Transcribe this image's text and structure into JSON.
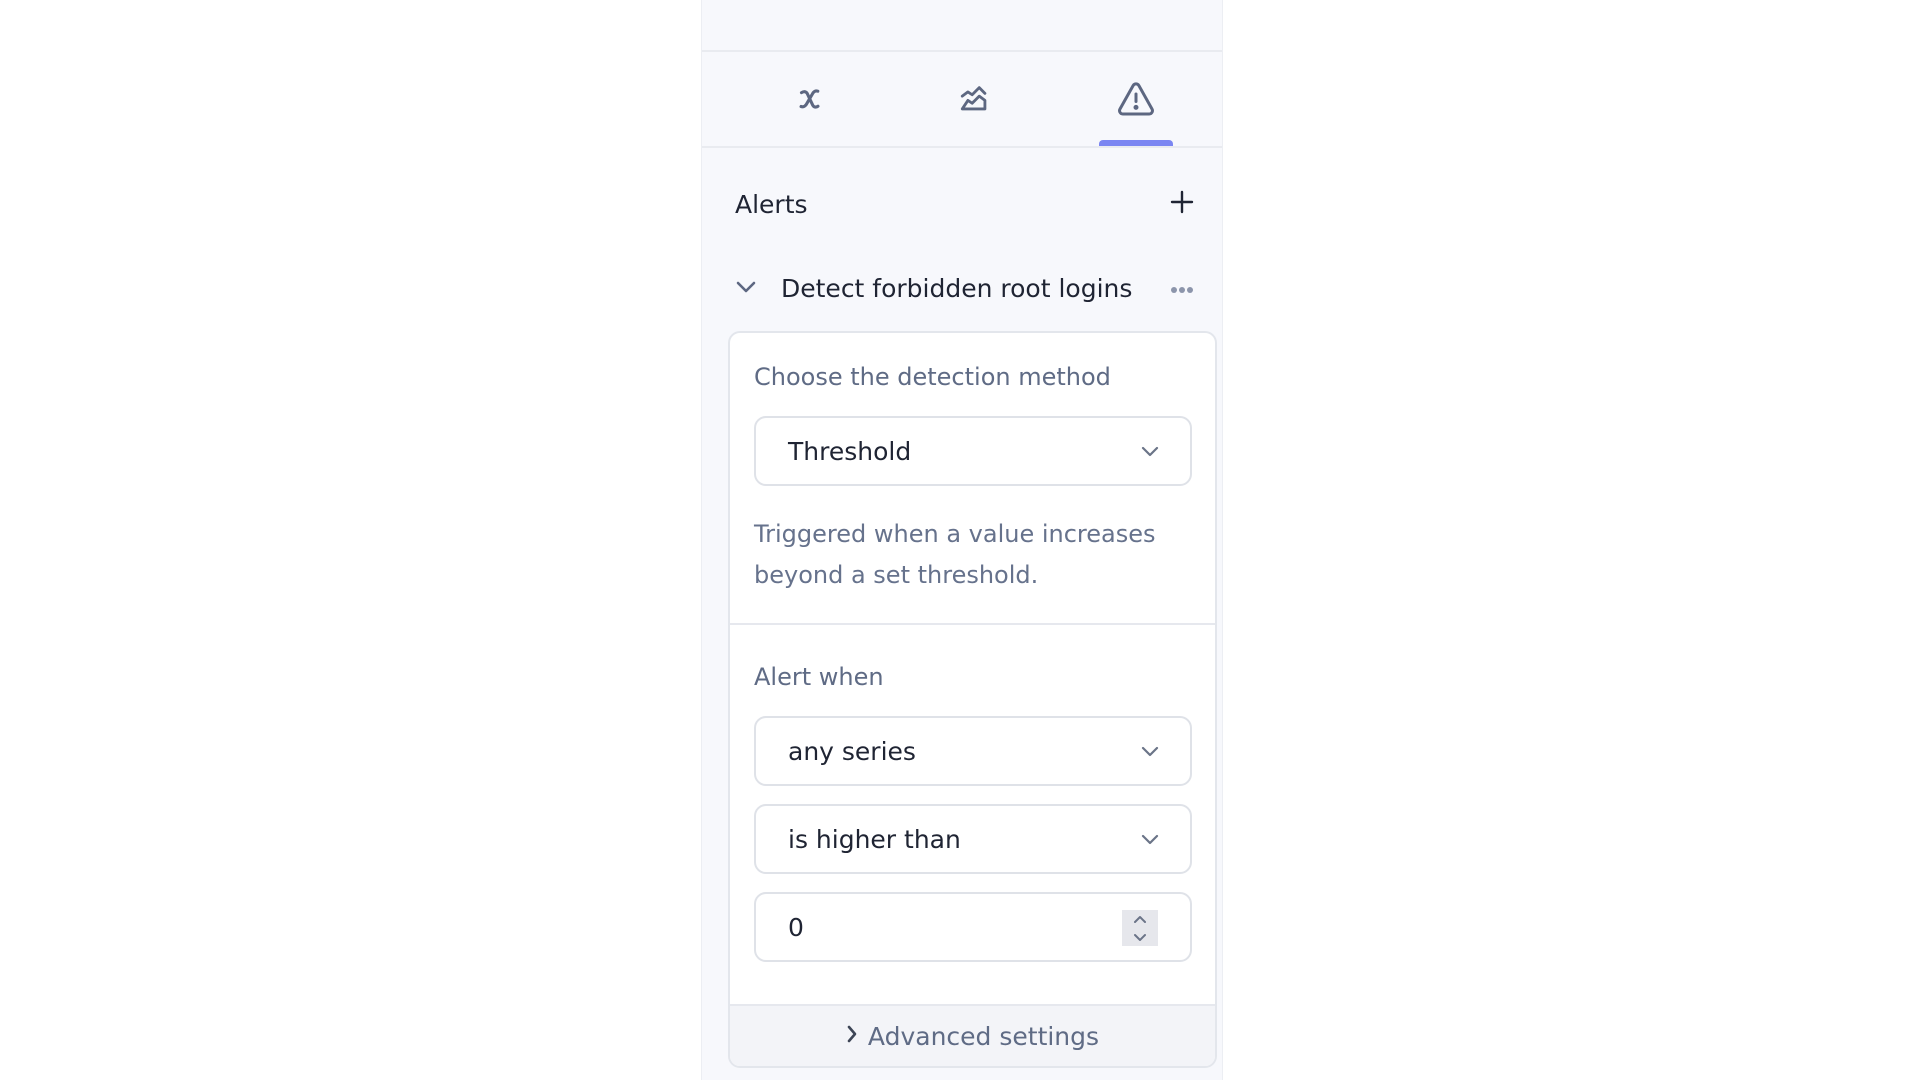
{
  "tabs": [
    {
      "name": "formula",
      "icon": "formula-x-icon",
      "active": false
    },
    {
      "name": "chart",
      "icon": "area-chart-icon",
      "active": false
    },
    {
      "name": "alerts",
      "icon": "warning-triangle-icon",
      "active": true
    }
  ],
  "colors": {
    "accent": "#7b86f2",
    "panel_bg": "#f7f8fc",
    "text_primary": "#1f2433",
    "text_secondary": "#5f6b85"
  },
  "alerts": {
    "title": "Alerts",
    "add_icon": "plus-icon",
    "items": [
      {
        "name": "Detect forbidden root logins",
        "expanded": true,
        "detection": {
          "label": "Choose the detection method",
          "method": "Threshold",
          "description": "Triggered when a value increases beyond a set threshold."
        },
        "condition": {
          "label": "Alert when",
          "series": "any series",
          "comparator": "is higher than",
          "value": "0"
        },
        "advanced_label": "Advanced settings"
      }
    ]
  }
}
